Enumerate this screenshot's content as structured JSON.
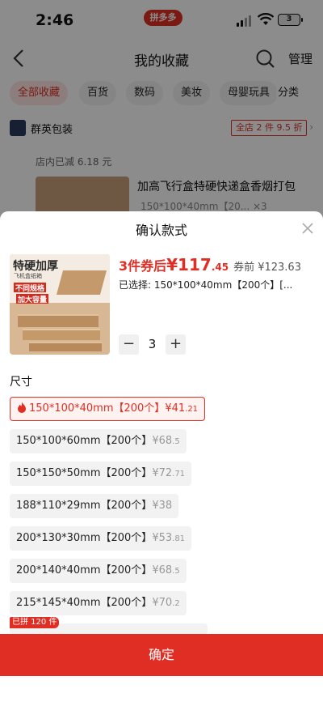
{
  "status_bar": {
    "time": "2:46",
    "app_badge": "拼多多",
    "battery": "3"
  },
  "nav": {
    "title": "我的收藏",
    "manage_label": "管理"
  },
  "tabs": [
    "全部收藏",
    "百货",
    "数码",
    "美妆",
    "母婴玩具",
    "分类"
  ],
  "shop": {
    "name": "群英包装",
    "badge": "全店 2 件 9.5 折"
  },
  "bg_product": {
    "discount_text": "店内已减 6.18 元",
    "title": "加高飞行盒特硬快递盒香烟打包",
    "spec": "150*100*40mm【20... ×3"
  },
  "sheet": {
    "title": "确认款式",
    "image_text": {
      "line1": "特硬加厚",
      "line2": "飞机盒纸箱",
      "line3": "不同规格",
      "line4": "加大容量"
    },
    "price_prefix": "3件券后",
    "price_main": "¥117",
    "price_decimal": ".45",
    "price_before": "券前 ¥123.63",
    "selected_text": "已选择: 150*100*40mm【200个】[...",
    "quantity": "3",
    "minus_label": "−",
    "plus_label": "+",
    "size_label": "尺寸",
    "options": [
      {
        "label": "150*100*40mm【200个】",
        "price": "¥41",
        "price_dec": ".21"
      },
      {
        "label": "150*100*60mm【200个】",
        "price": "¥68",
        "price_dec": ".5"
      },
      {
        "label": "150*150*50mm【200个】",
        "price": "¥72",
        "price_dec": ".71"
      },
      {
        "label": "188*110*29mm【200个】",
        "price": "¥38",
        "price_dec": ""
      },
      {
        "label": "200*130*30mm【200个】",
        "price": "¥53",
        "price_dec": ".81"
      },
      {
        "label": "200*140*40mm【200个】",
        "price": "¥68",
        "price_dec": ".5"
      },
      {
        "label": "215*145*40mm【200个】",
        "price": "¥70",
        "price_dec": ".2"
      }
    ],
    "sold_tag": "已拼 120 件",
    "confirm_label": "确定"
  },
  "colors": {
    "accent": "#e02e24",
    "selected_bg": "#fff3f2",
    "option_bg": "#f2f2f2"
  }
}
